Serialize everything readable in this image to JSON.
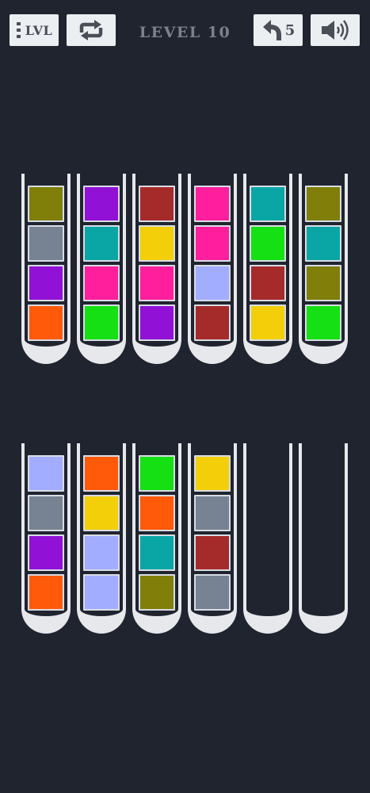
{
  "header": {
    "lvl_label": "LVL",
    "level_title": "LEVEL 10",
    "undo_count": "5"
  },
  "icons": {
    "level_menu": "level-list-icon",
    "restart": "restart-icon",
    "undo": "undo-icon",
    "sound": "speaker-icon"
  },
  "colors": {
    "background": "#20242f",
    "tube_glass": "#e6e8ec",
    "button_bg": "#eceff2",
    "olive": "#7f7f0a",
    "slate": "#778293",
    "purple": "#9111d6",
    "orange": "#ff5a0a",
    "teal": "#0aa6a6",
    "pink": "#ff1f9c",
    "green": "#14e014",
    "brown": "#a52b2b",
    "yellow": "#f2cf09",
    "periwinkle": "#a3adff"
  },
  "tubes": [
    {
      "row": 0,
      "col": 0,
      "balls": [
        "olive",
        "slate",
        "purple",
        "orange"
      ]
    },
    {
      "row": 0,
      "col": 1,
      "balls": [
        "purple",
        "teal",
        "pink",
        "green"
      ]
    },
    {
      "row": 0,
      "col": 2,
      "balls": [
        "brown",
        "yellow",
        "pink",
        "purple"
      ]
    },
    {
      "row": 0,
      "col": 3,
      "balls": [
        "pink",
        "pink",
        "periwinkle",
        "brown"
      ]
    },
    {
      "row": 0,
      "col": 4,
      "balls": [
        "teal",
        "green",
        "brown",
        "yellow"
      ]
    },
    {
      "row": 0,
      "col": 5,
      "balls": [
        "olive",
        "teal",
        "olive",
        "green"
      ]
    },
    {
      "row": 1,
      "col": 0,
      "balls": [
        "periwinkle",
        "slate",
        "purple",
        "orange"
      ]
    },
    {
      "row": 1,
      "col": 1,
      "balls": [
        "orange",
        "yellow",
        "periwinkle",
        "periwinkle"
      ]
    },
    {
      "row": 1,
      "col": 2,
      "balls": [
        "green",
        "orange",
        "teal",
        "olive"
      ]
    },
    {
      "row": 1,
      "col": 3,
      "balls": [
        "yellow",
        "slate",
        "brown",
        "slate"
      ]
    },
    {
      "row": 1,
      "col": 4,
      "balls": []
    },
    {
      "row": 1,
      "col": 5,
      "balls": []
    }
  ]
}
